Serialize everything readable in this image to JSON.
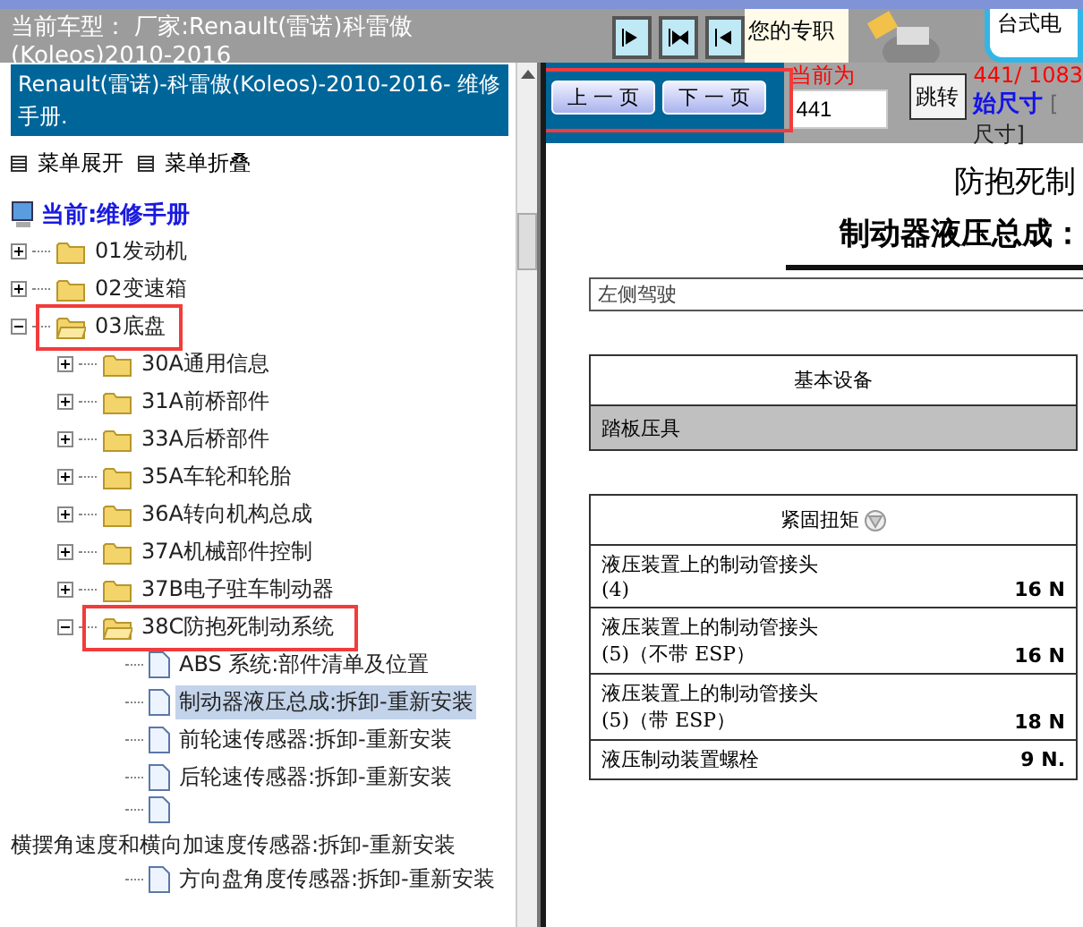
{
  "header": {
    "title_lines": [
      "当前车型： 厂家:Renault(雷诺)科雷傲",
      "(Koleos)2010-2016"
    ],
    "promo_text": "您的专职",
    "ad_text": "台式电"
  },
  "sidebar": {
    "heading": "Renault(雷诺)-科雷傲(Koleos)-2010-2016- 维修手册.",
    "menu": [
      {
        "label": "菜单展开"
      },
      {
        "label": "菜单折叠"
      }
    ],
    "root": "当前:维修手册",
    "tree": [
      {
        "kind": "folder",
        "label": "01发动机",
        "expanded": false,
        "marked": false
      },
      {
        "kind": "folder",
        "label": "02变速箱",
        "expanded": false,
        "marked": false
      },
      {
        "kind": "folder",
        "label": "03底盘",
        "expanded": true,
        "marked": true,
        "children": [
          {
            "kind": "folder",
            "label": "30A通用信息",
            "expanded": false,
            "marked": false
          },
          {
            "kind": "folder",
            "label": "31A前桥部件",
            "expanded": false,
            "marked": false
          },
          {
            "kind": "folder",
            "label": "33A后桥部件",
            "expanded": false,
            "marked": false
          },
          {
            "kind": "folder",
            "label": "35A车轮和轮胎",
            "expanded": false,
            "marked": false
          },
          {
            "kind": "folder",
            "label": "36A转向机构总成",
            "expanded": false,
            "marked": false
          },
          {
            "kind": "folder",
            "label": "37A机械部件控制",
            "expanded": false,
            "marked": false
          },
          {
            "kind": "folder",
            "label": "37B电子驻车制动器",
            "expanded": false,
            "marked": false
          },
          {
            "kind": "folder",
            "label": "38C防抱死制动系统",
            "expanded": true,
            "marked": true,
            "children": [
              {
                "kind": "page",
                "label": "ABS 系统:部件清单及位置",
                "selected": false
              },
              {
                "kind": "page",
                "label": "制动器液压总成:拆卸-重新安装",
                "selected": true
              },
              {
                "kind": "page",
                "label": "前轮速传感器:拆卸-重新安装",
                "selected": false
              },
              {
                "kind": "page",
                "label": "后轮速传感器:拆卸-重新安装",
                "selected": false
              },
              {
                "kind": "page",
                "label": "横摆角速度和横向加速度传感器:拆卸-重新安装",
                "selected": false
              },
              {
                "kind": "page",
                "label": "方向盘角度传感器:拆卸-重新安装",
                "selected": false
              }
            ]
          }
        ]
      }
    ]
  },
  "toolbar": {
    "marked": true,
    "prev": "上 一 页",
    "next": "下 一 页",
    "page_label": "当前为",
    "page_value": "441",
    "go": "跳转",
    "page_count": "441/ 1083",
    "size_link": "始尺寸",
    "size_bracket": "[",
    "size_tail": "尺寸]"
  },
  "document": {
    "title": "防抱死制",
    "subtitle": "制动器液压总成：",
    "section": "左侧驾驶",
    "equipment_table": {
      "header": "基本设备",
      "rows": [
        "踏板压具"
      ]
    },
    "torque_table": {
      "header": "紧固扭矩",
      "rows": [
        {
          "label": "液压装置上的制动管接头",
          "detail": "(4)",
          "value": "16 N"
        },
        {
          "label": "液压装置上的制动管接头",
          "detail": "(5)（不带 ESP）",
          "value": "16 N"
        },
        {
          "label": "液压装置上的制动管接头",
          "detail": "(5)（带 ESP）",
          "value": "18 N"
        },
        {
          "label": "液压制动装置螺栓",
          "value": "9 N."
        }
      ]
    }
  }
}
